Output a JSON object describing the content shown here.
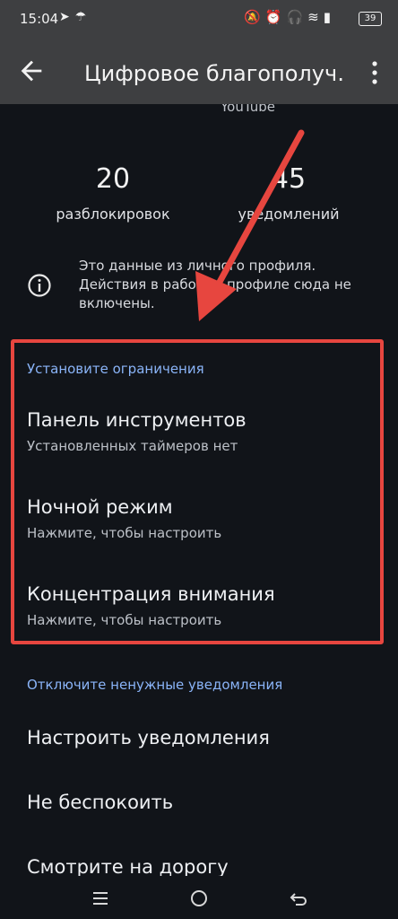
{
  "status_bar": {
    "time": "15:04",
    "battery": "39",
    "left_icons": [
      "telegram-icon",
      "umbrella-icon"
    ],
    "right_icons": [
      "mute-icon",
      "alarm-icon",
      "headset-icon",
      "wifi-icon",
      "signal-icon"
    ]
  },
  "appbar": {
    "title": "Цифровое благополуч…"
  },
  "summary": {
    "app_name": "YouTube",
    "unlocks_value": "20",
    "unlocks_label": "разблокировок",
    "notifications_value": "45",
    "notifications_label": "уведомлений"
  },
  "info": {
    "text": "Это данные из личного профиля. Действия в рабочем профиле сюда не включены."
  },
  "limits_section": {
    "header": "Установите ограничения",
    "items": [
      {
        "title": "Панель инструментов",
        "subtitle": "Установленных таймеров нет"
      },
      {
        "title": "Ночной режим",
        "subtitle": "Нажмите, чтобы настроить"
      },
      {
        "title": "Концентрация внимания",
        "subtitle": "Нажмите, чтобы настроить"
      }
    ]
  },
  "notifications_section": {
    "header": "Отключите ненужные уведомления",
    "items": [
      {
        "title": "Настроить уведомления"
      },
      {
        "title": "Не беспокоить"
      },
      {
        "title": "Смотрите на дорогу"
      }
    ]
  },
  "colors": {
    "background": "#111419",
    "appbar": "#3e3f41",
    "accent": "#8ab4f8",
    "annotation": "#e7463f"
  }
}
